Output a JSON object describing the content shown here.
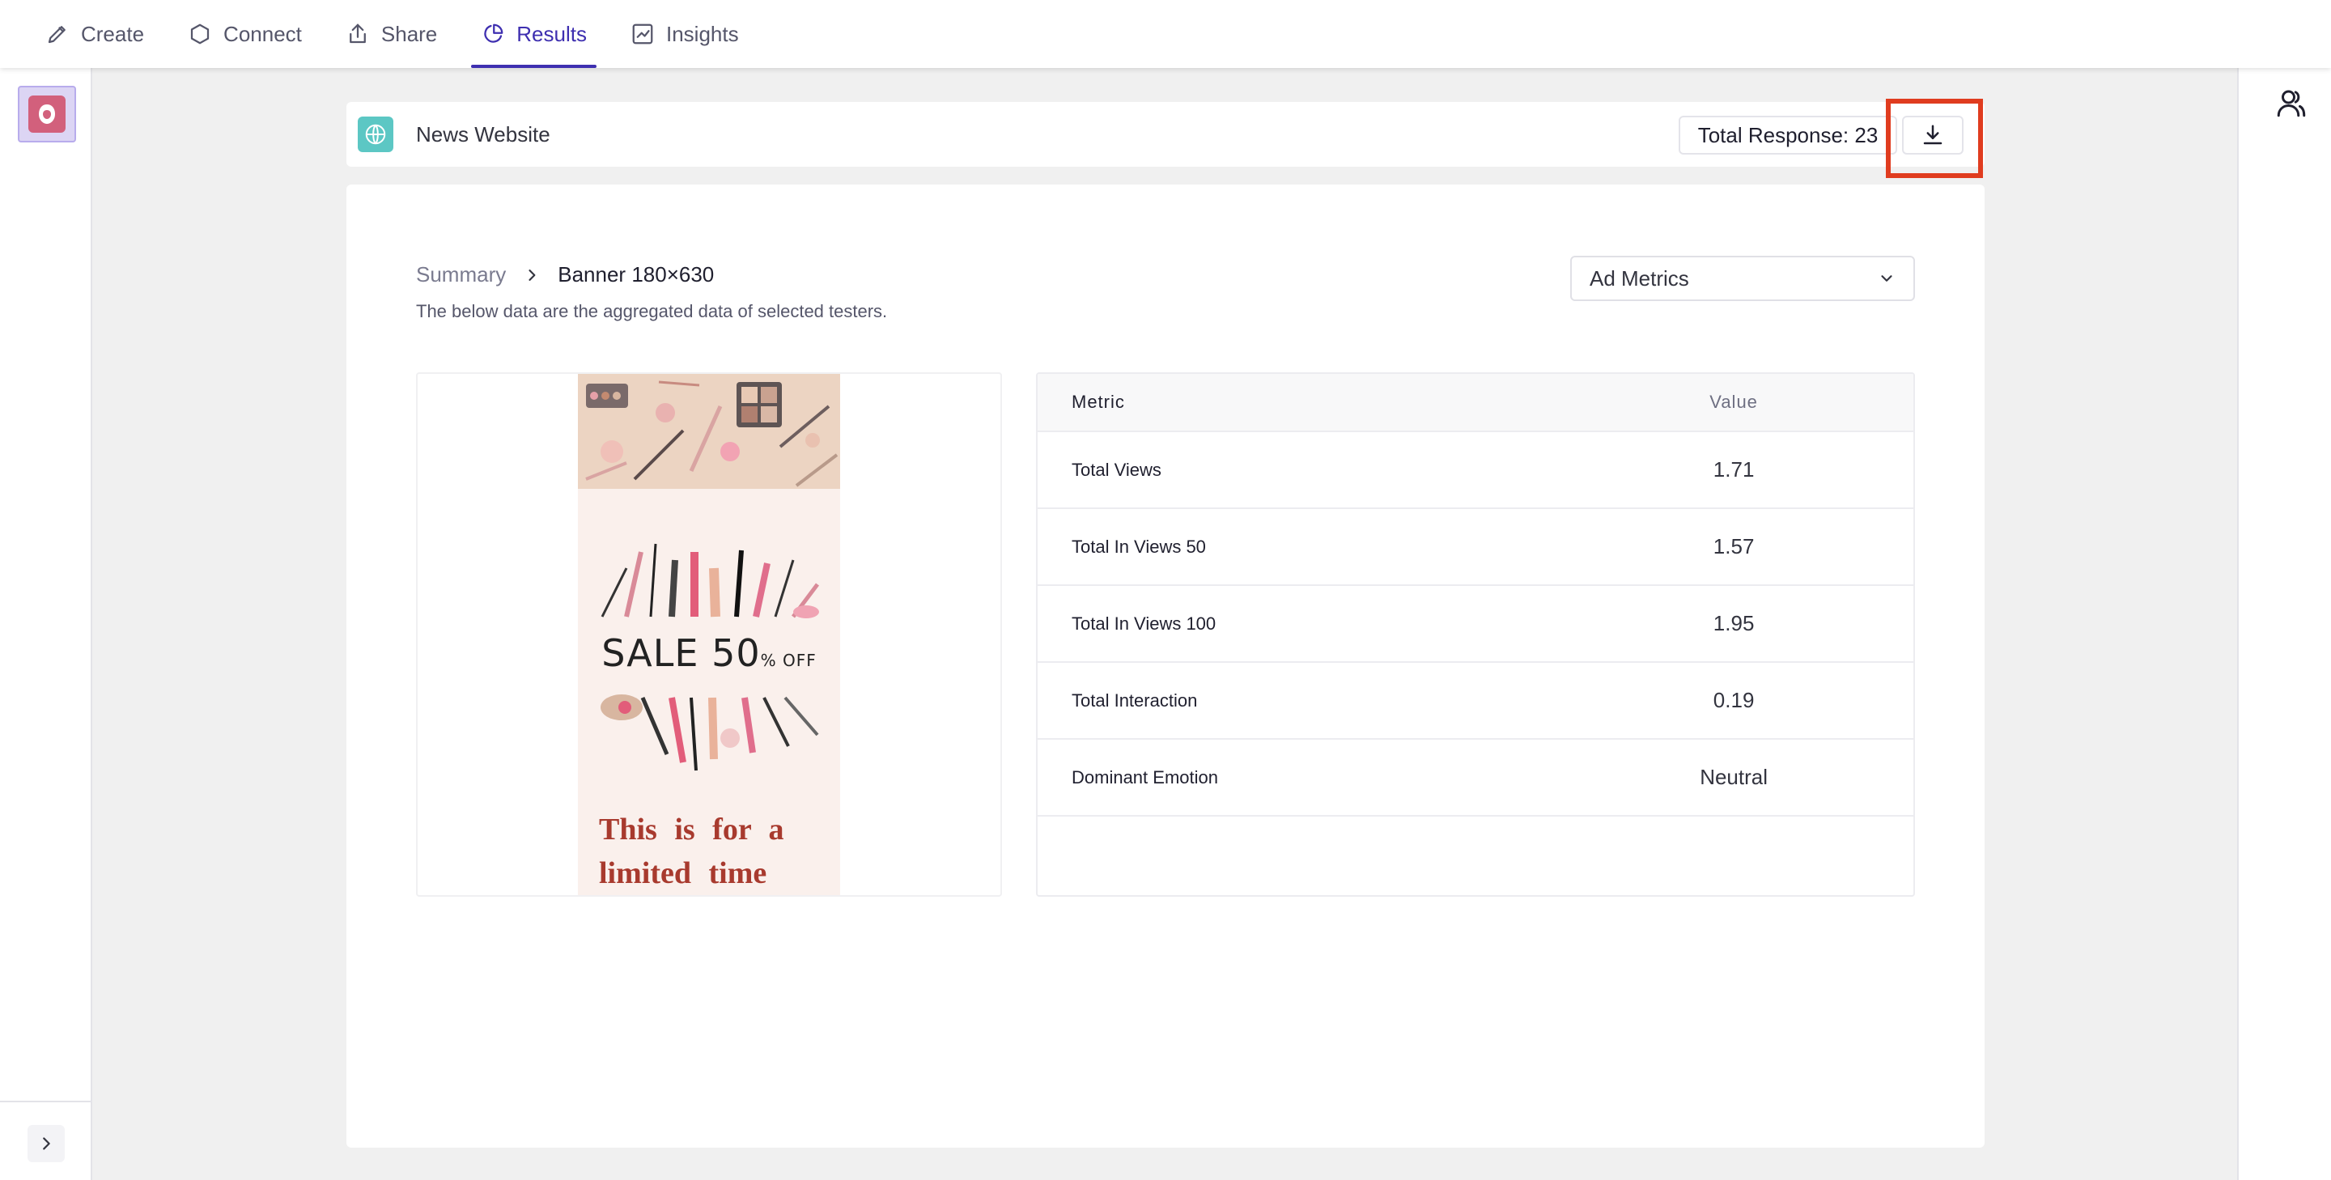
{
  "nav": {
    "tabs": [
      {
        "label": "Create",
        "icon": "pencil-icon"
      },
      {
        "label": "Connect",
        "icon": "hexagon-icon"
      },
      {
        "label": "Share",
        "icon": "share-upload-icon"
      },
      {
        "label": "Results",
        "icon": "pie-chart-icon",
        "active": true
      },
      {
        "label": "Insights",
        "icon": "line-chart-icon"
      }
    ],
    "accent": "#3e2fb0"
  },
  "header": {
    "site_name": "News Website",
    "total_response": "Total Response: 23",
    "download_icon": "download-icon",
    "highlight_color": "#e03c1f"
  },
  "main": {
    "breadcrumb": {
      "parent": "Summary",
      "current": "Banner 180×630"
    },
    "subtitle": "The below data are the aggregated data of selected testers.",
    "dropdown": {
      "selected": "Ad Metrics"
    },
    "banner": {
      "sale_text": "SALE 50",
      "sale_suffix": "% OFF",
      "tagline_line1": "This is for a",
      "tagline_line2": "limited time"
    },
    "table": {
      "headers": [
        "Metric",
        "Value"
      ],
      "rows": [
        {
          "metric": "Total Views",
          "value": "1.71"
        },
        {
          "metric": "Total In Views 50",
          "value": "1.57"
        },
        {
          "metric": "Total In Views 100",
          "value": "1.95"
        },
        {
          "metric": "Total Interaction",
          "value": "0.19"
        },
        {
          "metric": "Dominant Emotion",
          "value": "Neutral"
        }
      ]
    }
  }
}
